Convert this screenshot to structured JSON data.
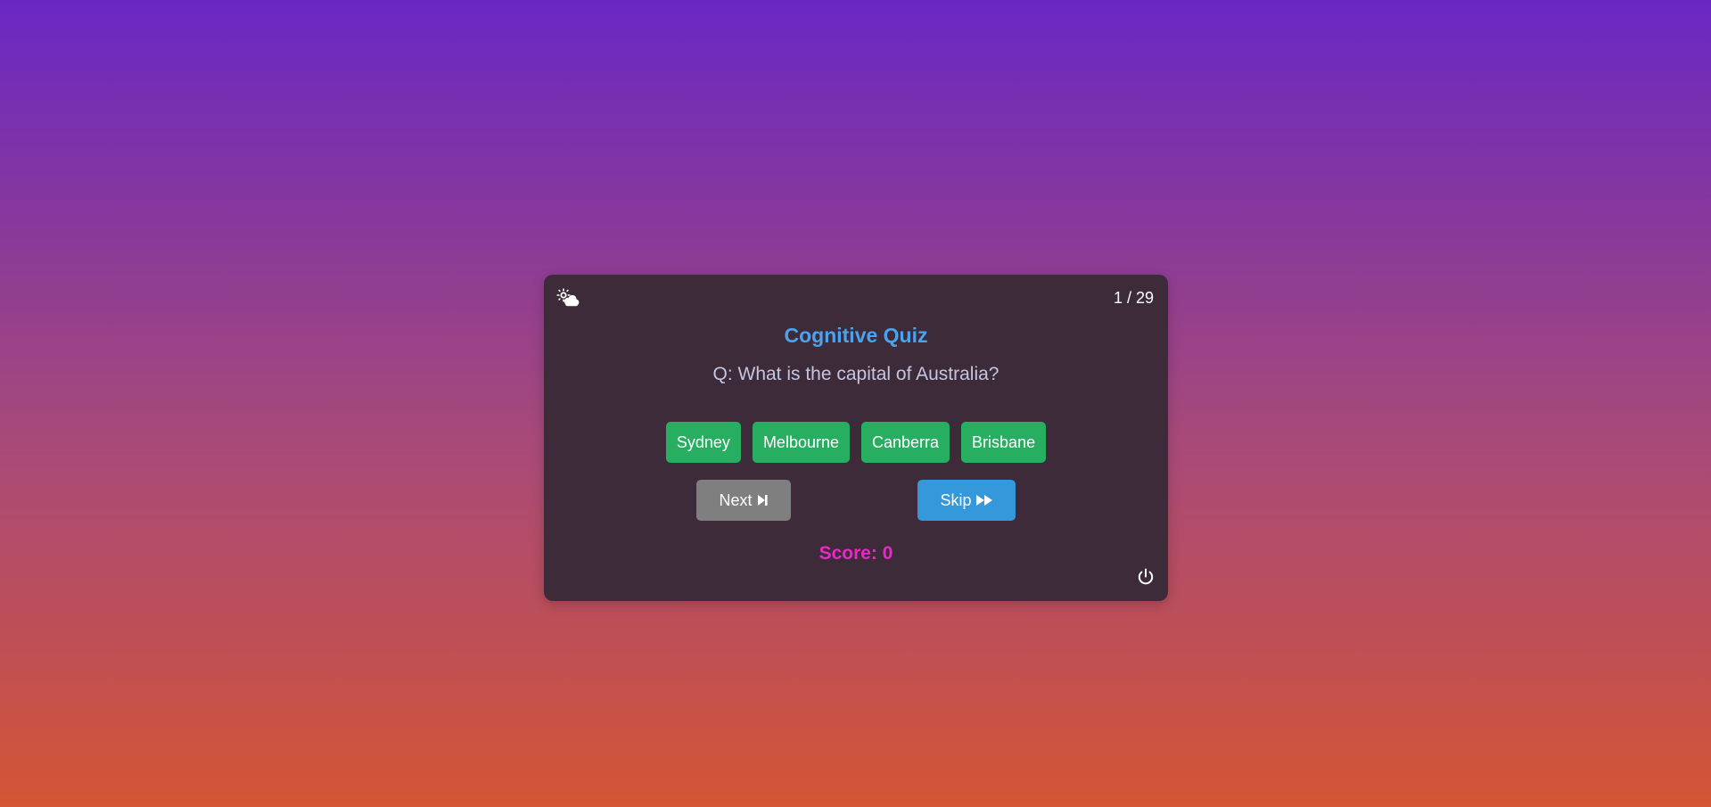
{
  "header": {
    "theme_icon": "sun-cloud-icon",
    "counter": "1 / 29"
  },
  "quiz": {
    "title": "Cognitive Quiz",
    "question": "Q: What is the capital of Australia?",
    "options": [
      "Sydney",
      "Melbourne",
      "Canberra",
      "Brisbane"
    ],
    "option_color": "#27ae60"
  },
  "controls": {
    "next_label": "Next",
    "next_icon": "step-forward-icon",
    "next_color": "#7f7f7f",
    "skip_label": "Skip",
    "skip_icon": "fast-forward-icon",
    "skip_color": "#3498db"
  },
  "score": {
    "text": "Score: 0",
    "color": "#ea28c6"
  },
  "footer": {
    "power_icon": "power-icon"
  },
  "colors": {
    "card_bg": "#3e2b3a",
    "title": "#4aa3ec",
    "gradient_top": "#6a27c4",
    "gradient_bottom": "#d45633"
  }
}
